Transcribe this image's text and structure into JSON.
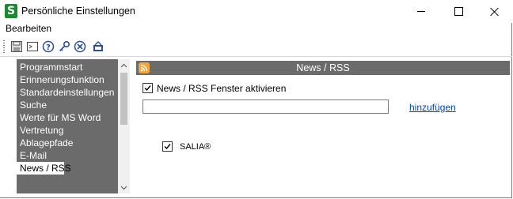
{
  "window": {
    "title": "Persönliche Einstellungen",
    "app_icon_letter": "S"
  },
  "menu": {
    "items": [
      "Bearbeiten"
    ]
  },
  "toolbar": {
    "buttons": [
      "save-icon",
      "console-icon",
      "help-icon",
      "key-icon",
      "cancel-icon",
      "exit-icon"
    ]
  },
  "sidebar": {
    "items": [
      {
        "label": "Programmstart"
      },
      {
        "label": "Erinnerungsfunktion"
      },
      {
        "label": "Standardeinstellungen"
      },
      {
        "label": "Suche"
      },
      {
        "label": "Werte für MS Word"
      },
      {
        "label": "Vertretung"
      },
      {
        "label": "Ablagepfade"
      },
      {
        "label": "E-Mail"
      },
      {
        "label": "News / RSS"
      }
    ],
    "selected": "News / RSS"
  },
  "content": {
    "header_title": "News / RSS",
    "enable_checkbox_label": "News / RSS Fenster aktivieren",
    "enable_checked": true,
    "feed_url_value": "",
    "add_link_label": "hinzufügen",
    "feeds": [
      {
        "label": "SALIA®",
        "checked": true
      }
    ]
  },
  "colors": {
    "panel_gray": "#6b6b6b",
    "link_blue": "#0044cc",
    "rss_orange": "#f3a63a",
    "app_green": "#1a8a2e"
  }
}
